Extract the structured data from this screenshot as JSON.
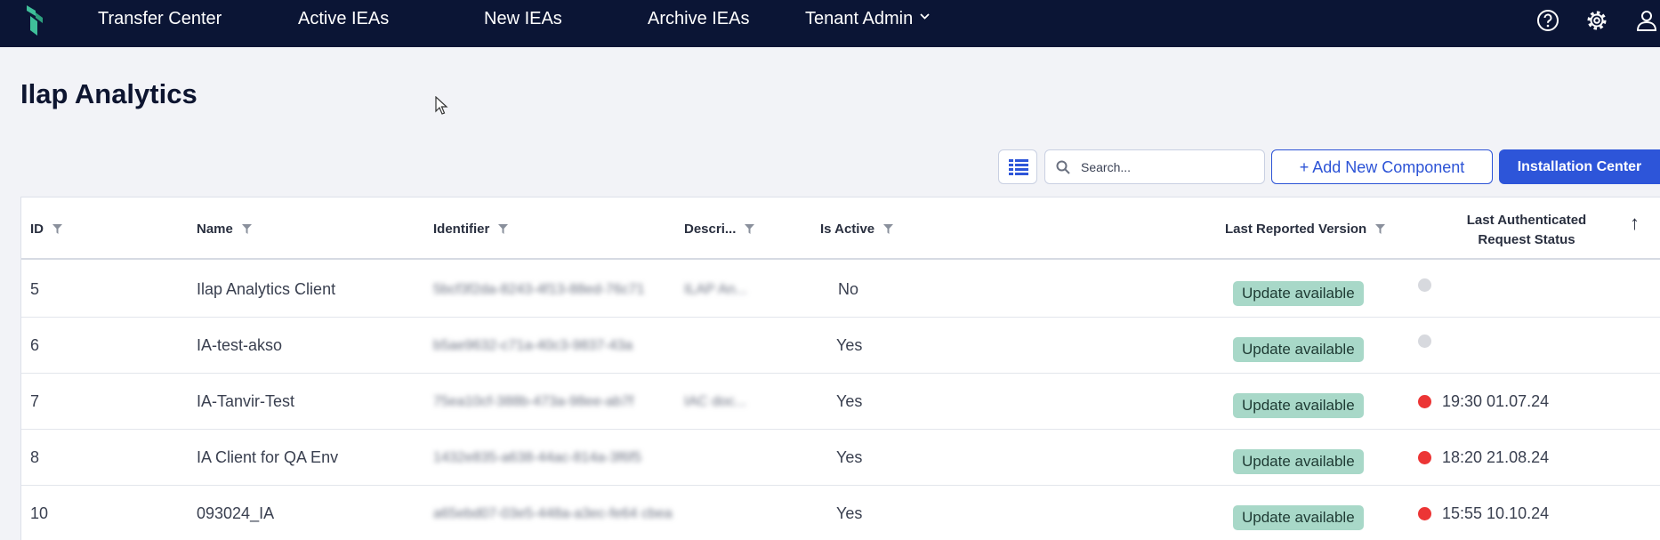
{
  "nav": {
    "items": [
      {
        "label": "Transfer Center"
      },
      {
        "label": "Active IEAs"
      },
      {
        "label": "New IEAs"
      },
      {
        "label": "Archive IEAs"
      },
      {
        "label": "Tenant Admin"
      }
    ]
  },
  "page": {
    "title": "Ilap Analytics"
  },
  "toolbar": {
    "search_placeholder": "Search...",
    "add_label": "+ Add New Component",
    "install_label": "Installation Center"
  },
  "table": {
    "headers": {
      "id": "ID",
      "name": "Name",
      "identifier": "Identifier",
      "description": "Descri...",
      "is_active": "Is Active",
      "last_version": "Last Reported Version",
      "last_auth": "Last Authenticated Request Status"
    },
    "rows": [
      {
        "id": "5",
        "name": "Ilap Analytics Client",
        "identifier": "5bcf3f2da-8243-4f13-88ed-76c71",
        "description": "ILAP An...",
        "is_active": "No",
        "version": "Update available",
        "status": "",
        "status_color": "grey"
      },
      {
        "id": "6",
        "name": "IA-test-akso",
        "identifier": "b5ae9632-c71a-40c3-9837-43a",
        "description": "",
        "is_active": "Yes",
        "version": "Update available",
        "status": "",
        "status_color": "grey"
      },
      {
        "id": "7",
        "name": "IA-Tanvir-Test",
        "identifier": "75ea10cf-388b-473a-98ee-ab7f",
        "description": "IAC doc...",
        "is_active": "Yes",
        "version": "Update available",
        "status": "19:30 01.07.24",
        "status_color": "red"
      },
      {
        "id": "8",
        "name": "IA Client for QA Env",
        "identifier": "1432e835-a638-44ac-814a-3f6f5",
        "description": "",
        "is_active": "Yes",
        "version": "Update available",
        "status": "18:20 21.08.24",
        "status_color": "red"
      },
      {
        "id": "10",
        "name": "093024_IA",
        "identifier": "a65ebd07-03e5-448a-a3ec-fe64 cbea",
        "description": "",
        "is_active": "Yes",
        "version": "Update available",
        "status": "15:55 10.10.24",
        "status_color": "red"
      }
    ]
  },
  "colors": {
    "nav_bg": "#0b1535",
    "accent": "#2d55d9",
    "badge_bg": "#a8d8c8",
    "status_red": "#ec3535",
    "status_grey": "#d7d9de"
  }
}
